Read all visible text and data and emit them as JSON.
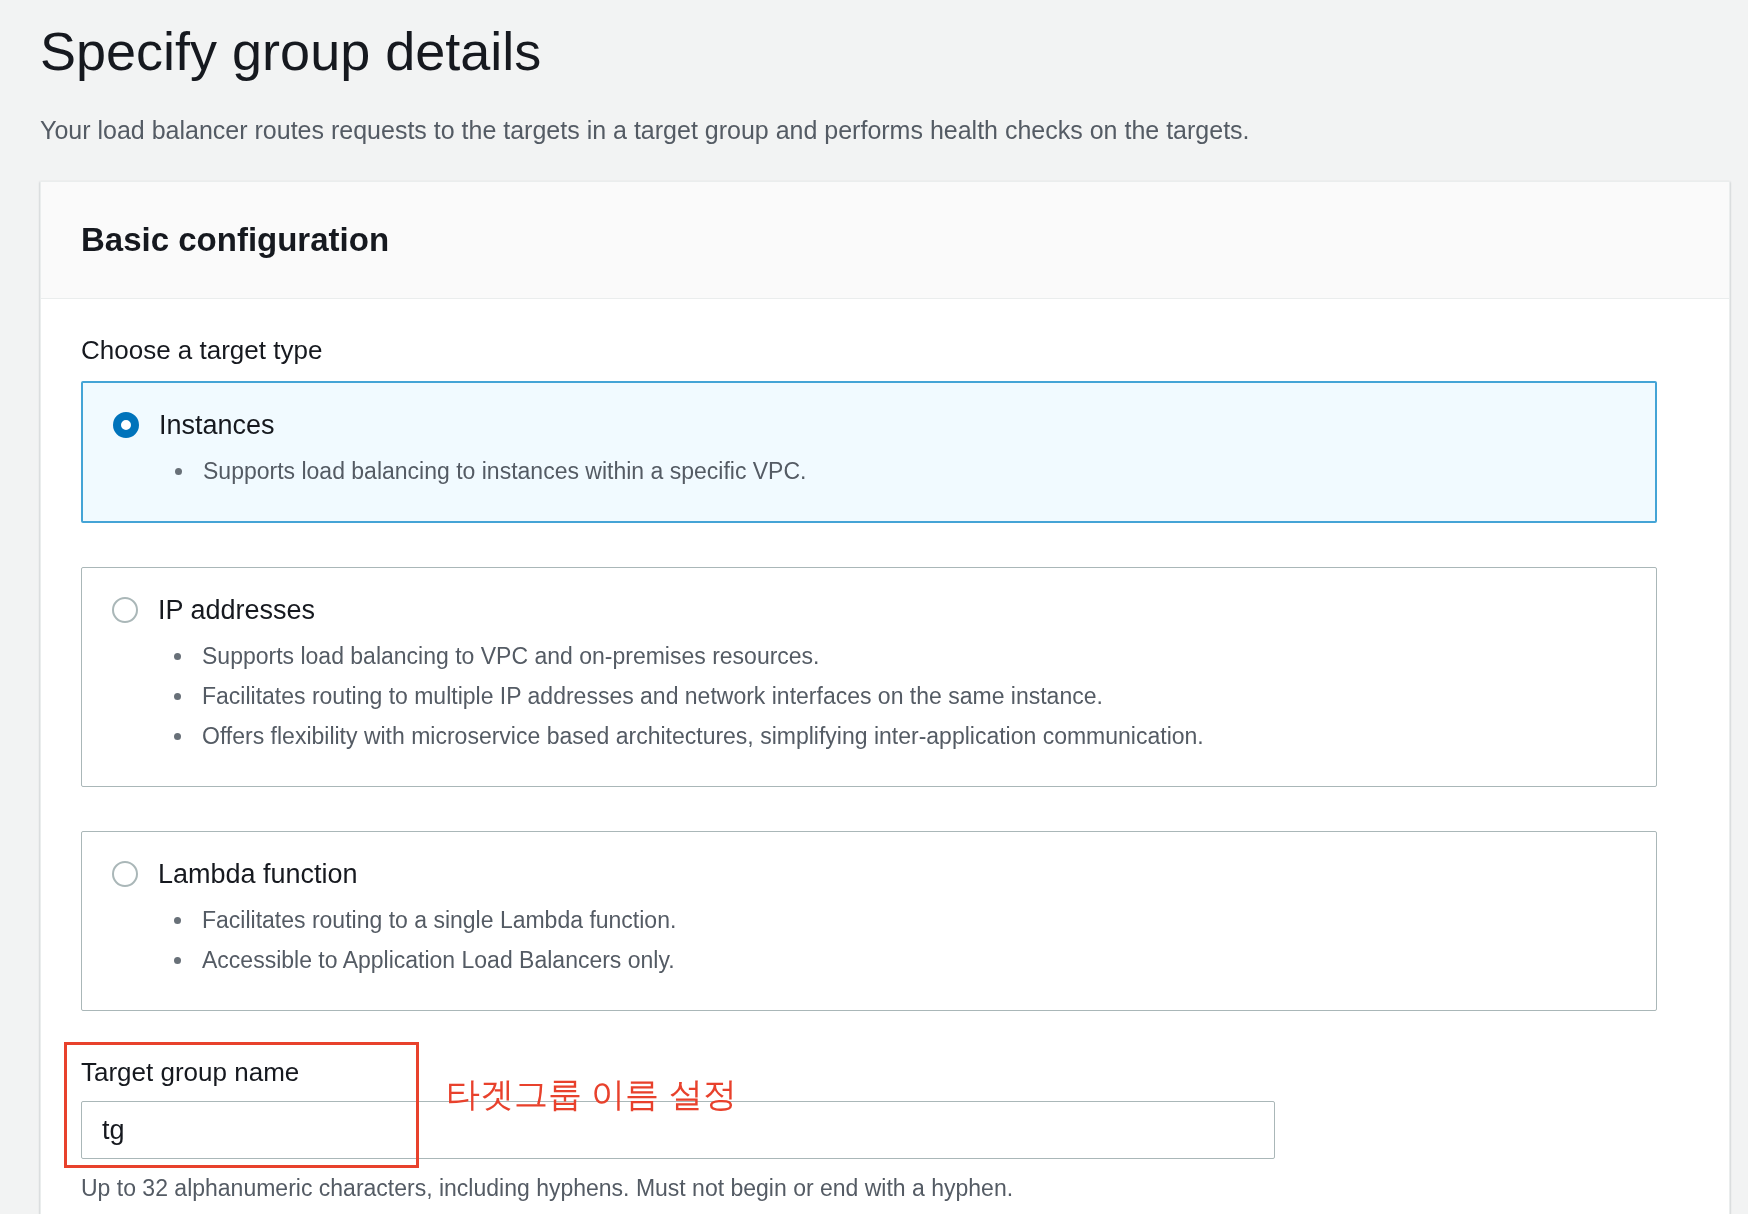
{
  "page": {
    "title": "Specify group details",
    "description": "Your load balancer routes requests to the targets in a target group and performs health checks on the targets."
  },
  "panel": {
    "title": "Basic configuration",
    "target_type": {
      "label": "Choose a target type",
      "options": [
        {
          "label": "Instances",
          "selected": true,
          "bullets": [
            "Supports load balancing to instances within a specific VPC."
          ]
        },
        {
          "label": "IP addresses",
          "selected": false,
          "bullets": [
            "Supports load balancing to VPC and on-premises resources.",
            "Facilitates routing to multiple IP addresses and network interfaces on the same instance.",
            "Offers flexibility with microservice based architectures, simplifying inter-application communication."
          ]
        },
        {
          "label": "Lambda function",
          "selected": false,
          "bullets": [
            "Facilitates routing to a single Lambda function.",
            "Accessible to Application Load Balancers only."
          ]
        }
      ]
    },
    "name_field": {
      "label": "Target group name",
      "value": "tg",
      "hint": "Up to 32 alphanumeric characters, including hyphens. Must not begin or end with a hyphen."
    }
  },
  "annotation": {
    "text": "타겟그룹 이름 설정"
  }
}
